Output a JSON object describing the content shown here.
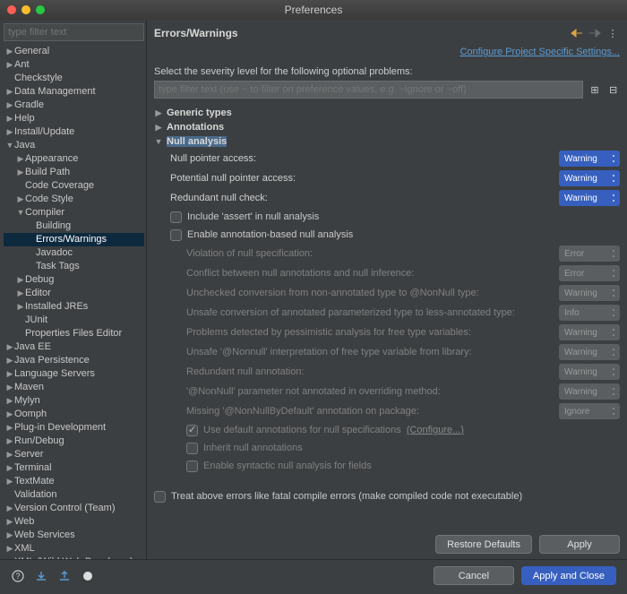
{
  "window": {
    "title": "Preferences"
  },
  "sidebar": {
    "filter_placeholder": "type filter text",
    "items": [
      {
        "label": "General",
        "depth": 0,
        "arrow": "▶"
      },
      {
        "label": "Ant",
        "depth": 0,
        "arrow": "▶"
      },
      {
        "label": "Checkstyle",
        "depth": 0,
        "arrow": ""
      },
      {
        "label": "Data Management",
        "depth": 0,
        "arrow": "▶"
      },
      {
        "label": "Gradle",
        "depth": 0,
        "arrow": "▶"
      },
      {
        "label": "Help",
        "depth": 0,
        "arrow": "▶"
      },
      {
        "label": "Install/Update",
        "depth": 0,
        "arrow": "▶"
      },
      {
        "label": "Java",
        "depth": 0,
        "arrow": "▼"
      },
      {
        "label": "Appearance",
        "depth": 1,
        "arrow": "▶"
      },
      {
        "label": "Build Path",
        "depth": 1,
        "arrow": "▶"
      },
      {
        "label": "Code Coverage",
        "depth": 1,
        "arrow": ""
      },
      {
        "label": "Code Style",
        "depth": 1,
        "arrow": "▶"
      },
      {
        "label": "Compiler",
        "depth": 1,
        "arrow": "▼"
      },
      {
        "label": "Building",
        "depth": 2,
        "arrow": ""
      },
      {
        "label": "Errors/Warnings",
        "depth": 2,
        "arrow": "",
        "selected": true
      },
      {
        "label": "Javadoc",
        "depth": 2,
        "arrow": ""
      },
      {
        "label": "Task Tags",
        "depth": 2,
        "arrow": ""
      },
      {
        "label": "Debug",
        "depth": 1,
        "arrow": "▶"
      },
      {
        "label": "Editor",
        "depth": 1,
        "arrow": "▶"
      },
      {
        "label": "Installed JREs",
        "depth": 1,
        "arrow": "▶"
      },
      {
        "label": "JUnit",
        "depth": 1,
        "arrow": ""
      },
      {
        "label": "Properties Files Editor",
        "depth": 1,
        "arrow": ""
      },
      {
        "label": "Java EE",
        "depth": 0,
        "arrow": "▶"
      },
      {
        "label": "Java Persistence",
        "depth": 0,
        "arrow": "▶"
      },
      {
        "label": "Language Servers",
        "depth": 0,
        "arrow": "▶"
      },
      {
        "label": "Maven",
        "depth": 0,
        "arrow": "▶"
      },
      {
        "label": "Mylyn",
        "depth": 0,
        "arrow": "▶"
      },
      {
        "label": "Oomph",
        "depth": 0,
        "arrow": "▶"
      },
      {
        "label": "Plug-in Development",
        "depth": 0,
        "arrow": "▶"
      },
      {
        "label": "Run/Debug",
        "depth": 0,
        "arrow": "▶"
      },
      {
        "label": "Server",
        "depth": 0,
        "arrow": "▶"
      },
      {
        "label": "Terminal",
        "depth": 0,
        "arrow": "▶"
      },
      {
        "label": "TextMate",
        "depth": 0,
        "arrow": "▶"
      },
      {
        "label": "Validation",
        "depth": 0,
        "arrow": ""
      },
      {
        "label": "Version Control (Team)",
        "depth": 0,
        "arrow": "▶"
      },
      {
        "label": "Web",
        "depth": 0,
        "arrow": "▶"
      },
      {
        "label": "Web Services",
        "depth": 0,
        "arrow": "▶"
      },
      {
        "label": "XML",
        "depth": 0,
        "arrow": "▶"
      },
      {
        "label": "XML (Wild Web Developer)",
        "depth": 0,
        "arrow": "▶"
      }
    ]
  },
  "page": {
    "title": "Errors/Warnings",
    "configure_link": "Configure Project Specific Settings...",
    "desc": "Select the severity level for the following optional problems:",
    "inner_filter_placeholder": "type filter text (use ~ to filter on preference values, e.g. ~ignore or ~off)",
    "categories": [
      {
        "label": "Generic types",
        "expanded": false
      },
      {
        "label": "Annotations",
        "expanded": false
      },
      {
        "label": "Null analysis",
        "expanded": true,
        "selected": true
      }
    ],
    "settings": [
      {
        "label": "Null pointer access:",
        "value": "Warning",
        "enabled": true
      },
      {
        "label": "Potential null pointer access:",
        "value": "Warning",
        "enabled": true
      },
      {
        "label": "Redundant null check:",
        "value": "Warning",
        "enabled": true
      }
    ],
    "checks": [
      {
        "label": "Include 'assert' in null analysis",
        "checked": false,
        "enabled": true
      },
      {
        "label": "Enable annotation-based null analysis",
        "checked": false,
        "enabled": true
      }
    ],
    "annot_settings": [
      {
        "label": "Violation of null specification:",
        "value": "Error"
      },
      {
        "label": "Conflict between null annotations and null inference:",
        "value": "Error"
      },
      {
        "label": "Unchecked conversion from non-annotated type to @NonNull type:",
        "value": "Warning"
      },
      {
        "label": "Unsafe conversion of annotated parameterized type to less-annotated type:",
        "value": "Info"
      },
      {
        "label": "Problems detected by pessimistic analysis for free type variables:",
        "value": "Warning"
      },
      {
        "label": "Unsafe '@Nonnull' interpretation of free type variable from library:",
        "value": "Warning"
      },
      {
        "label": "Redundant null annotation:",
        "value": "Warning"
      },
      {
        "label": "'@NonNull' parameter not annotated in overriding method:",
        "value": "Warning"
      },
      {
        "label": "Missing '@NonNullByDefault' annotation on package:",
        "value": "Ignore"
      }
    ],
    "annot_checks": [
      {
        "label": "Use default annotations for null specifications",
        "checked": true,
        "configure": "(Configure...)"
      },
      {
        "label": "Inherit null annotations",
        "checked": false
      },
      {
        "label": "Enable syntactic null analysis for fields",
        "checked": false
      }
    ],
    "fatal_check": {
      "label": "Treat above errors like fatal compile errors (make compiled code not executable)",
      "checked": false
    },
    "restore": "Restore Defaults",
    "apply": "Apply"
  },
  "footer": {
    "cancel": "Cancel",
    "apply_close": "Apply and Close"
  }
}
